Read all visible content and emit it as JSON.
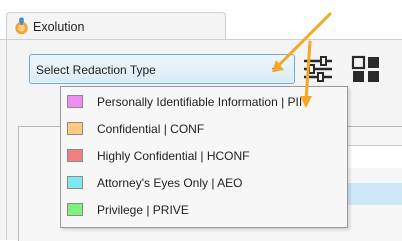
{
  "window": {
    "title": "Exolution"
  },
  "toolbar": {
    "select_placeholder": "Select Redaction Type",
    "filter_icon": "sliders-icon",
    "layout_icon": "layout-grid-icon"
  },
  "redaction_types": [
    {
      "label": "Personally Identifiable Information | PII",
      "color": "#f08cf0"
    },
    {
      "label": "Confidential | CONF",
      "color": "#ffc983"
    },
    {
      "label": "Highly Confidential | HCONF",
      "color": "#f08181"
    },
    {
      "label": "Attorney's Eyes Only | AEO",
      "color": "#7fe9f2"
    },
    {
      "label": "Privilege  | PRIVE",
      "color": "#7ef07e"
    }
  ],
  "annotation": {
    "arrow_color": "#f5a623"
  }
}
